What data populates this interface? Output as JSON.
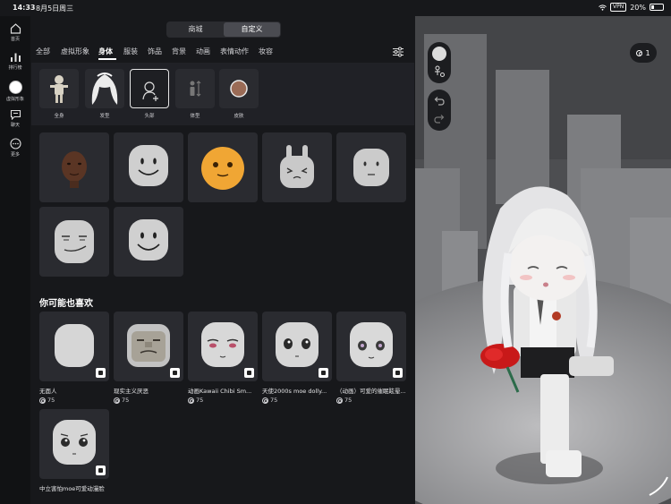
{
  "status": {
    "time": "14:33",
    "date": "8月5日周三",
    "vpn": "VPN",
    "battery": "20%"
  },
  "nav": [
    {
      "label": "首页",
      "icon": "home-icon"
    },
    {
      "label": "排行榜",
      "icon": "chart-icon"
    },
    {
      "label": "虚拟形象",
      "icon": "avatar-icon"
    },
    {
      "label": "聊天",
      "icon": "chat-icon"
    },
    {
      "label": "更多",
      "icon": "more-icon"
    }
  ],
  "top_tabs": {
    "shop": "商城",
    "custom": "自定义"
  },
  "category_tabs": [
    "全部",
    "虚拟形象",
    "身体",
    "服装",
    "饰品",
    "背景",
    "动画",
    "表情动作",
    "妆容"
  ],
  "sub_items": [
    "全身",
    "发型",
    "头部",
    "体型",
    "皮肤"
  ],
  "owned_heads": [
    "dark-skin-head",
    "smile-head",
    "orange-blob-head",
    "bunny-head",
    "plain-head",
    "man-face-head",
    "classic-smile-head"
  ],
  "recommend_title": "你可能也喜欢",
  "recommend": [
    {
      "name": "无面人",
      "price": "75"
    },
    {
      "name": "现实主义厌恶",
      "price": "75"
    },
    {
      "name": "动画Kawaii Chibi Sm...",
      "price": "75"
    },
    {
      "name": "天使2000s moe dolly...",
      "price": "75"
    },
    {
      "name": "（动画）可爱的催眠眩晕...",
      "price": "75"
    },
    {
      "name": "中立害怕moe可爱动漫脸",
      "price": ""
    }
  ],
  "preview": {
    "coin_count": "1"
  },
  "colors": {
    "accent": "#ffffff",
    "bg": "#17181b",
    "card": "#2a2b30"
  }
}
